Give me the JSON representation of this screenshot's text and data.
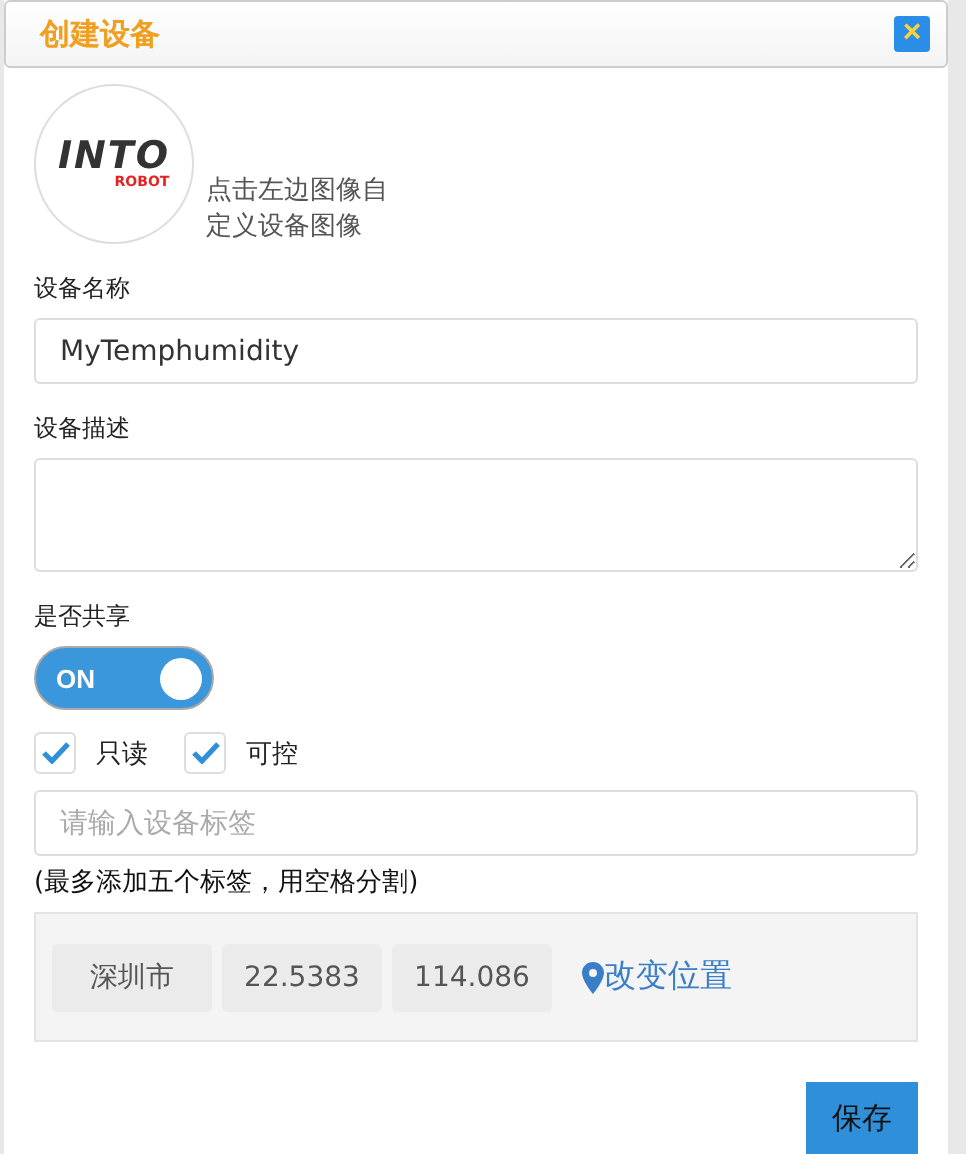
{
  "dialog": {
    "title": "创建设备",
    "close": "×"
  },
  "avatar": {
    "logo": "INTO",
    "logo_sub": "ROBOT",
    "hint": "点击左边图像自定义设备图像"
  },
  "fields": [
    {
      "kind": "input",
      "label": "设备名称",
      "value": "MyTemphumidity"
    },
    {
      "kind": "textarea",
      "label": "设备描述"
    }
  ],
  "share": {
    "label": "是否共享",
    "on": true,
    "on_text": "ON"
  },
  "checkboxes": [
    {
      "label": "只读",
      "checked": true
    },
    {
      "label": "可控",
      "checked": true
    }
  ],
  "tags": {
    "placeholder": "请输入设备标签",
    "hint": "(最多添加五个标签，用空格分割)"
  },
  "location": {
    "city": "深圳市",
    "lat": "22.5383",
    "lng": "114.086",
    "link": "改变位置"
  },
  "save_button": "保存"
}
